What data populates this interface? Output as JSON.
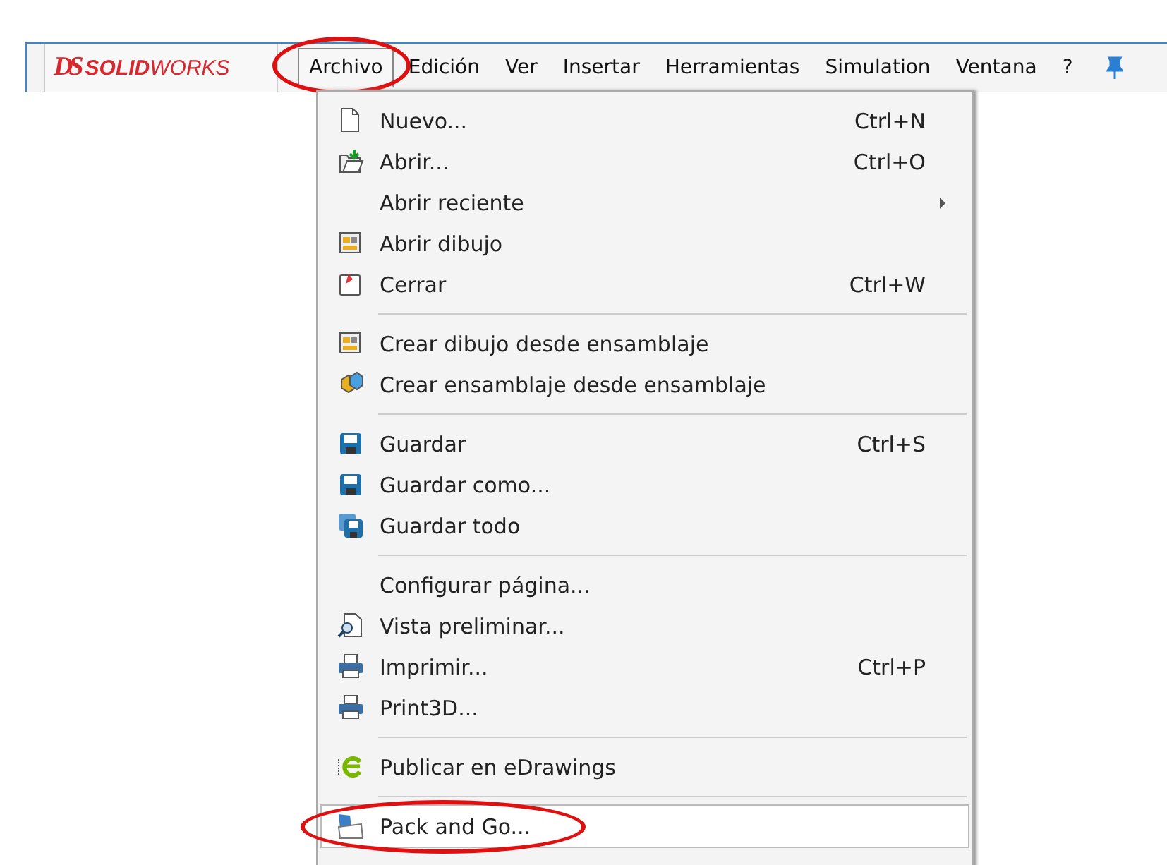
{
  "app": {
    "logo_mark": "DS",
    "logo_text_bold": "SOLID",
    "logo_text_light": "WORKS"
  },
  "menubar": [
    {
      "label": "Archivo",
      "selected": true,
      "circled": true
    },
    {
      "label": "Edición",
      "selected": false,
      "circled": false
    },
    {
      "label": "Ver",
      "selected": false,
      "circled": false
    },
    {
      "label": "Insertar",
      "selected": false,
      "circled": false
    },
    {
      "label": "Herramientas",
      "selected": false,
      "circled": false
    },
    {
      "label": "Simulation",
      "selected": false,
      "circled": false
    },
    {
      "label": "Ventana",
      "selected": false,
      "circled": false
    },
    {
      "label": "?",
      "selected": false,
      "circled": false
    }
  ],
  "menu": [
    {
      "kind": "item",
      "label": "Nuevo...",
      "shortcut": "Ctrl+N",
      "selected": false,
      "circled": false
    },
    {
      "kind": "item",
      "label": "Abrir...",
      "shortcut": "Ctrl+O",
      "selected": false,
      "circled": false
    },
    {
      "kind": "submenu",
      "label": "Abrir reciente",
      "selected": false,
      "circled": false
    },
    {
      "kind": "item",
      "label": "Abrir dibujo",
      "selected": false,
      "circled": false
    },
    {
      "kind": "item",
      "label": "Cerrar",
      "shortcut": "Ctrl+W",
      "selected": false,
      "circled": false
    },
    {
      "kind": "separator"
    },
    {
      "kind": "item",
      "label": "Crear dibujo desde ensamblaje",
      "selected": false,
      "circled": false
    },
    {
      "kind": "item",
      "label": "Crear ensamblaje desde ensamblaje",
      "selected": false,
      "circled": false
    },
    {
      "kind": "separator"
    },
    {
      "kind": "item",
      "label": "Guardar",
      "shortcut": "Ctrl+S",
      "selected": false,
      "circled": false
    },
    {
      "kind": "item",
      "label": "Guardar como...",
      "selected": false,
      "circled": false
    },
    {
      "kind": "item",
      "label": "Guardar todo",
      "selected": false,
      "circled": false
    },
    {
      "kind": "separator"
    },
    {
      "kind": "item",
      "label": "Configurar página...",
      "selected": false,
      "circled": false
    },
    {
      "kind": "item",
      "label": "Vista preliminar...",
      "selected": false,
      "circled": false
    },
    {
      "kind": "item",
      "label": "Imprimir...",
      "shortcut": "Ctrl+P",
      "selected": false,
      "circled": false
    },
    {
      "kind": "item",
      "label": "Print3D...",
      "selected": false,
      "circled": false
    },
    {
      "kind": "separator"
    },
    {
      "kind": "item",
      "label": "Publicar en eDrawings",
      "selected": false,
      "circled": false
    },
    {
      "kind": "separator"
    },
    {
      "kind": "item",
      "label": "Pack and Go...",
      "selected": true,
      "circled": true
    }
  ]
}
